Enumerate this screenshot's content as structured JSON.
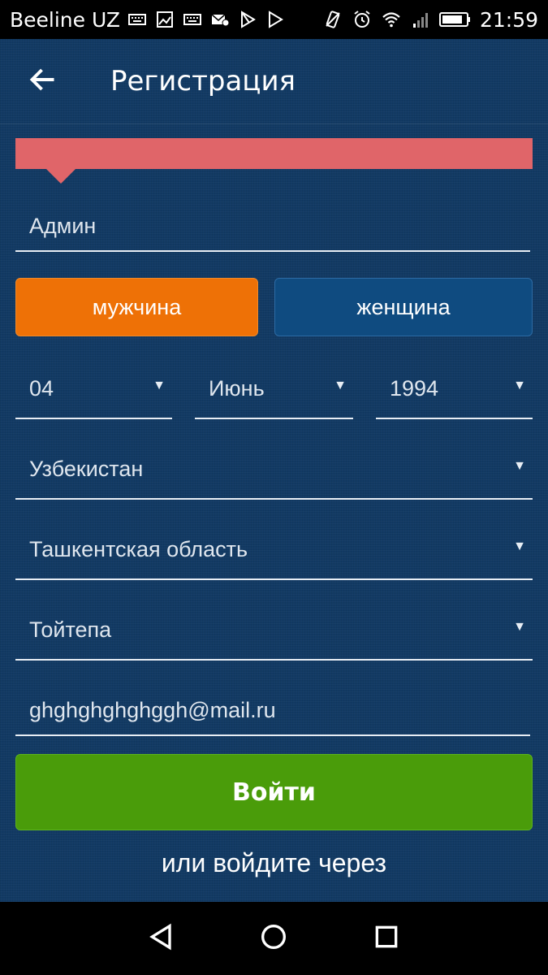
{
  "status_bar": {
    "carrier": "Beeline UZ",
    "time": "21:59",
    "left_icons": [
      "keyboard-icon",
      "image-icon",
      "keyboard-icon",
      "mail-icon",
      "play-store-icon",
      "play-icon"
    ],
    "right_icons": [
      "vibrate-icon",
      "alarm-icon",
      "wifi-icon",
      "signal-icon",
      "battery-icon"
    ]
  },
  "app_bar": {
    "title": "Регистрация",
    "back_icon": "arrow-left-icon"
  },
  "banner": {
    "color": "#e06569"
  },
  "form": {
    "name_value": "Админ",
    "gender": {
      "male_label": "мужчина",
      "female_label": "женщина",
      "selected": "male"
    },
    "birth": {
      "day": "04",
      "month": "Июнь",
      "year": "1994"
    },
    "country": "Узбекистан",
    "region": "Ташкентская область",
    "city": "Тойтепа",
    "email_value": "ghghghghghggh@mail.ru",
    "submit_label": "Войти",
    "or_label": "или войдите через"
  },
  "colors": {
    "background": "#123a64",
    "male_button": "#ee7106",
    "female_button": "#0f4b80",
    "submit_button": "#4a9c0a"
  },
  "nav_bar": {
    "icons": [
      "back-triangle-icon",
      "home-circle-icon",
      "recents-square-icon"
    ]
  }
}
